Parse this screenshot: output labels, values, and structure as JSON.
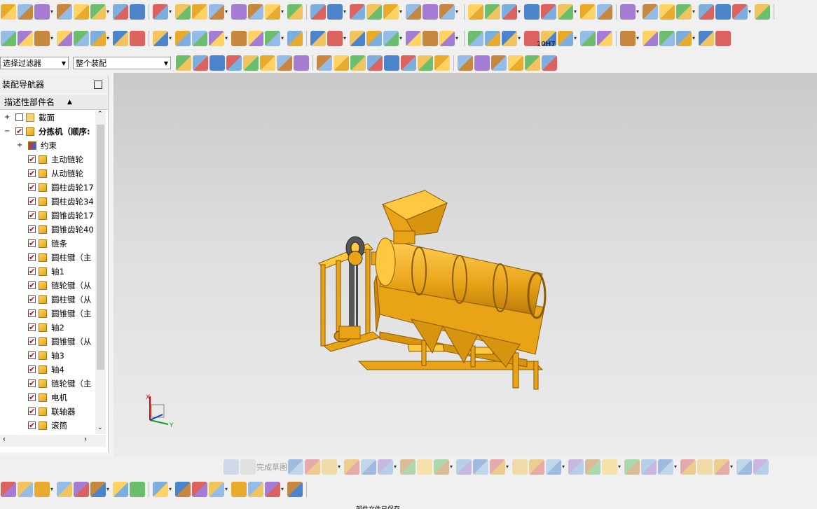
{
  "filter_bar": {
    "selection_filter": "选择过滤器",
    "scope": "整个装配"
  },
  "navigator": {
    "title": "装配导航器",
    "column_header": "描述性部件名",
    "root_section": "截面",
    "assembly": "分拣机（顺序:",
    "constraints": "约束",
    "parts": [
      "主动链轮",
      "从动链轮",
      "圆柱齿轮17",
      "圆柱齿轮34",
      "圆锥齿轮17",
      "圆锥齿轮40",
      "链条",
      "圆柱键（主",
      "轴1",
      "链轮键（从",
      "圆柱键（从",
      "圆锥键（主",
      "轴2",
      "圆锥键（从",
      "轴3",
      "轴4",
      "链轮键（主",
      "电机",
      "联轴器",
      "滚筒"
    ]
  },
  "sketch_toolbar": {
    "finish_sketch": "完成草图"
  },
  "toolbar_dims_label": "10H7",
  "viewport": {
    "triad_x": "X",
    "triad_y": "Y"
  },
  "colors": {
    "part": "#e8a317",
    "part_dark": "#b97a0a",
    "part_light": "#ffc840",
    "check": "#dd0000"
  },
  "status_text": "部件文件已保存"
}
